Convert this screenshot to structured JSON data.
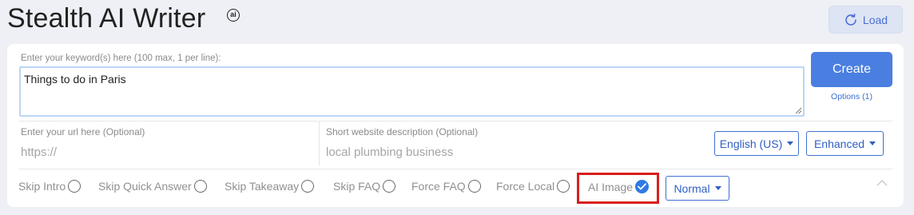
{
  "header": {
    "title": "Stealth AI Writer",
    "badge": "ai",
    "load_label": "Load"
  },
  "keywords": {
    "label": "Enter your keyword(s) here (100 max, 1 per line):",
    "value": "Things to do in Paris"
  },
  "actions": {
    "create_label": "Create",
    "options_label": "Options (1)"
  },
  "url_field": {
    "label": "Enter your url here (Optional)",
    "placeholder": "https://"
  },
  "description_field": {
    "label": "Short website description (Optional)",
    "placeholder": "local plumbing business"
  },
  "dropdowns": {
    "language": "English (US)",
    "mode": "Enhanced",
    "image_style": "Normal"
  },
  "options": [
    {
      "label": "Skip Intro",
      "checked": false
    },
    {
      "label": "Skip Quick Answer",
      "checked": false
    },
    {
      "label": "Skip Takeaway",
      "checked": false
    },
    {
      "label": "Skip FAQ",
      "checked": false
    },
    {
      "label": "Force FAQ",
      "checked": false
    },
    {
      "label": "Force Local",
      "checked": false
    },
    {
      "label": "AI Image",
      "checked": true
    }
  ],
  "colors": {
    "accent": "#4a7ee0",
    "highlight": "#d81e1e",
    "check": "#2f7ae5"
  }
}
